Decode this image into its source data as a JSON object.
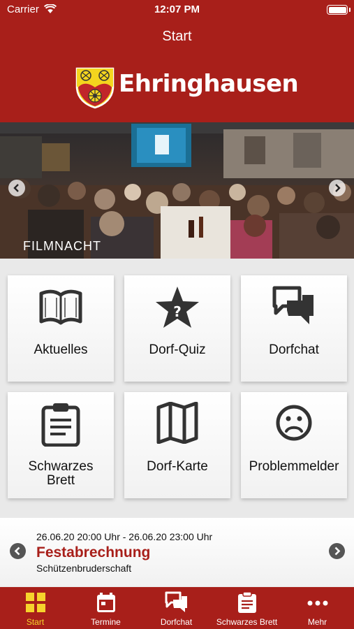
{
  "status_bar": {
    "carrier": "Carrier",
    "time": "12:07 PM"
  },
  "nav": {
    "title": "Start"
  },
  "logo": {
    "text": "Ehringhausen"
  },
  "banner": {
    "caption": "FILMNACHT"
  },
  "tiles": [
    {
      "label": "Aktuelles",
      "icon": "book-icon"
    },
    {
      "label": "Dorf-Quiz",
      "icon": "star-question-icon"
    },
    {
      "label": "Dorfchat",
      "icon": "chat-bubbles-icon"
    },
    {
      "label": "Schwarzes Brett",
      "label_lines": [
        "Schwarzes",
        "Brett"
      ],
      "icon": "clipboard-icon"
    },
    {
      "label": "Dorf-Karte",
      "icon": "map-icon"
    },
    {
      "label": "Problemmelder",
      "icon": "sad-face-icon"
    }
  ],
  "event": {
    "time": "26.06.20 20:00 Uhr - 26.06.20 23:00 Uhr",
    "title": "Festabrechnung",
    "organizer": "Schützenbruderschaft"
  },
  "tabbar": [
    {
      "label": "Start",
      "icon": "grid-icon",
      "active": true
    },
    {
      "label": "Termine",
      "icon": "calendar-icon",
      "active": false
    },
    {
      "label": "Dorfchat",
      "icon": "chat-icon",
      "active": false
    },
    {
      "label": "Schwarzes Brett",
      "icon": "clipboard-icon",
      "active": false
    },
    {
      "label": "Mehr",
      "icon": "more-dots-icon",
      "active": false
    }
  ],
  "colors": {
    "brand_red": "#a81f1a",
    "active_tab": "#f6d32c",
    "icon_gray": "#333333"
  }
}
